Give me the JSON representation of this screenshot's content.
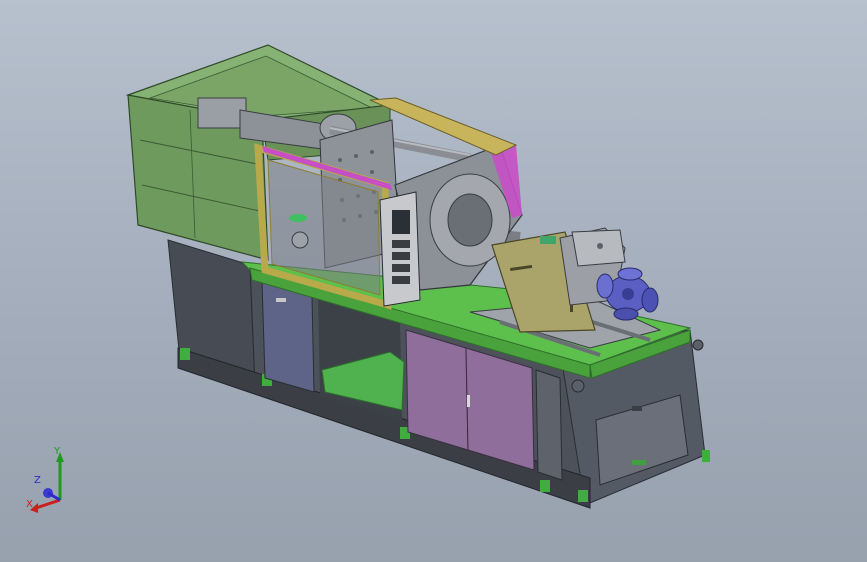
{
  "viewport": {
    "background_top": "#b7c0cd",
    "background_bottom": "#97a1ae"
  },
  "model": {
    "description_icon": "injection-molding-machine-3d-model",
    "colors": {
      "frame_green": "#5fbf4f",
      "guard_green": "#6f9a5e",
      "base_dark": "#4a4f57",
      "cabinet_purple": "#8a6f9a",
      "mold_yellow": "#b8a94a",
      "mold_plate_gray": "#8a8f96",
      "magenta_trim": "#c64fc6",
      "hopper_blue": "#5a5fc0",
      "panel_gray": "#6a6f7a",
      "shield_khaki": "#a8a26a"
    }
  },
  "triad": {
    "x_label": "X",
    "y_label": "Y",
    "z_label": "Z",
    "x_color": "#cc1f1f",
    "y_color": "#1f9a1f",
    "z_color": "#2a2acf"
  }
}
